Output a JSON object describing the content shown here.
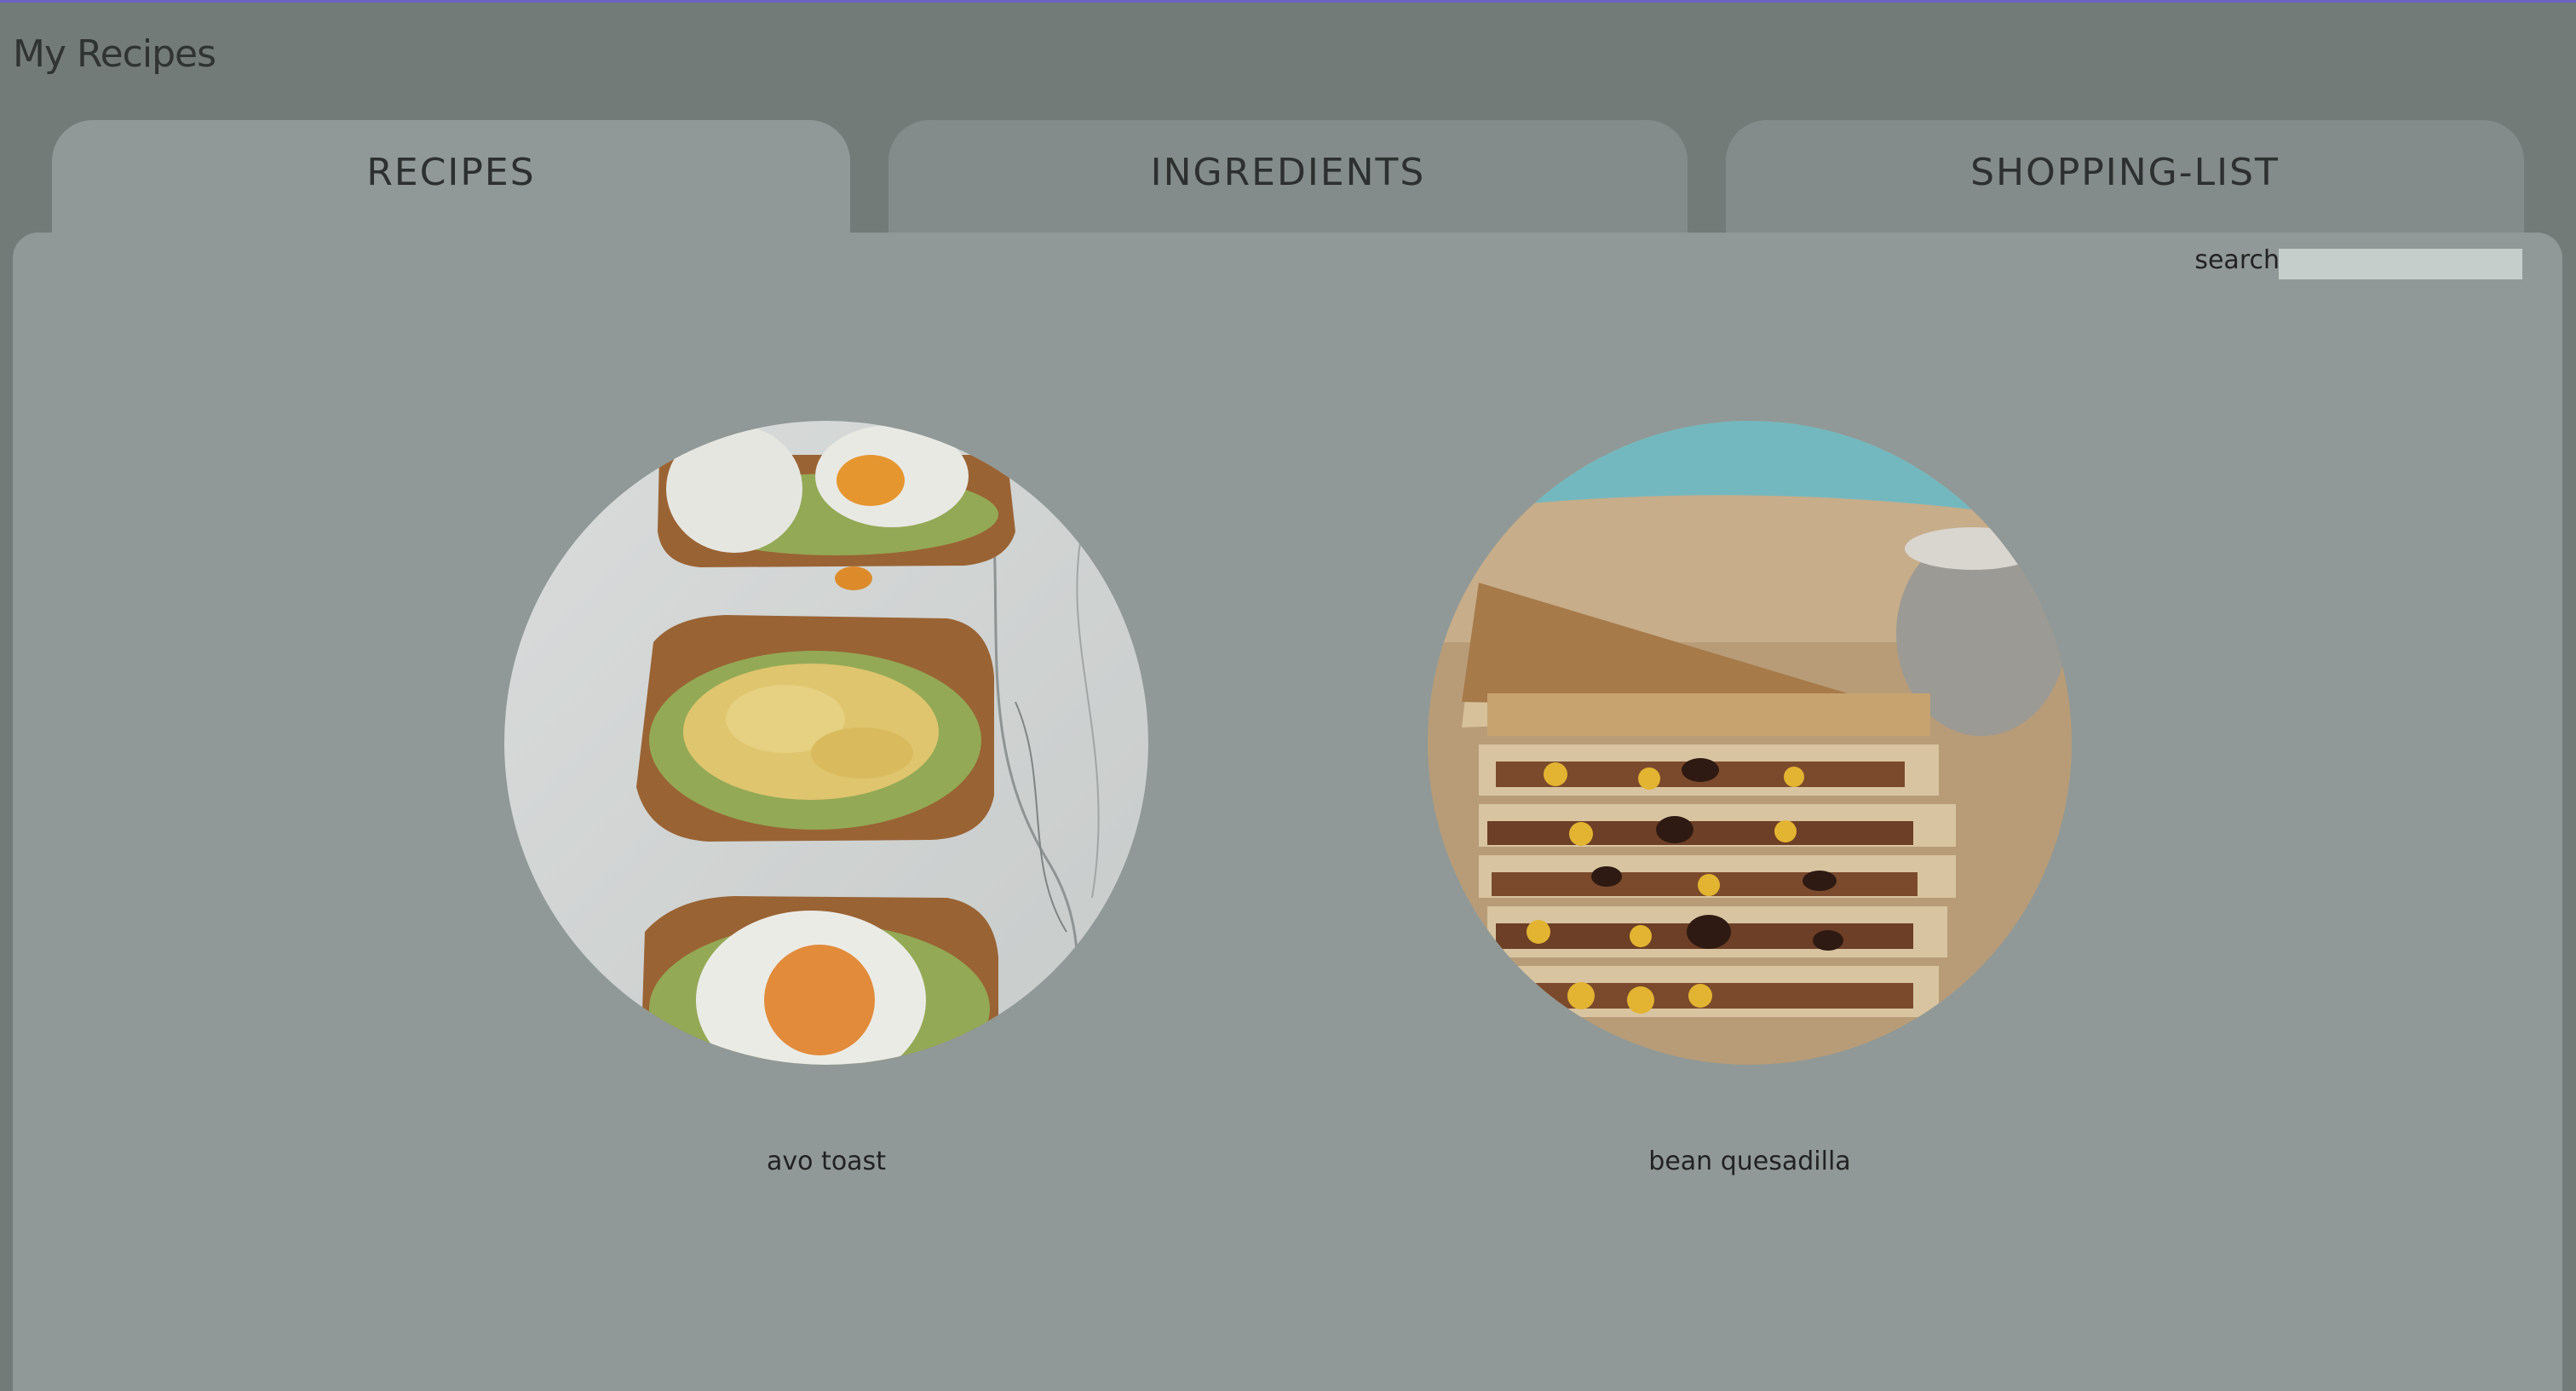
{
  "app": {
    "title": "My Recipes"
  },
  "tabs": [
    {
      "label": "RECIPES",
      "active": true
    },
    {
      "label": "INGREDIENTS",
      "active": false
    },
    {
      "label": "SHOPPING-LIST",
      "active": false
    }
  ],
  "search": {
    "label": "search",
    "value": "",
    "placeholder": ""
  },
  "recipes": [
    {
      "name": "avo toast",
      "image": "avocado-toast-photo"
    },
    {
      "name": "bean quesadilla",
      "image": "bean-quesadilla-photo"
    }
  ],
  "colors": {
    "background": "#737b79",
    "panel": "#909997",
    "tab_inactive": "#838c8a",
    "search_field": "#c6cecc",
    "accent_line": "#6b62c4"
  }
}
